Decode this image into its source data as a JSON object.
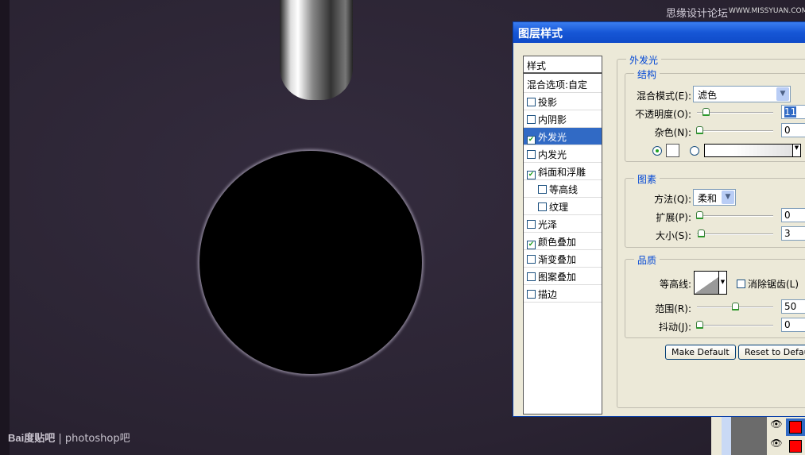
{
  "watermark_top": {
    "cn": "思缘设计论坛",
    "url": "WWW.MISSYUAN.COM"
  },
  "watermark_bottom": {
    "logo": "Bai度贴吧",
    "text": "photoshop吧"
  },
  "dialog": {
    "title": "图层样式",
    "styles_header": "样式",
    "blend_options": "混合选项:自定",
    "items": [
      {
        "label": "投影",
        "checked": false,
        "indent": false
      },
      {
        "label": "内阴影",
        "checked": false,
        "indent": false
      },
      {
        "label": "外发光",
        "checked": true,
        "indent": false,
        "selected": true
      },
      {
        "label": "内发光",
        "checked": false,
        "indent": false
      },
      {
        "label": "斜面和浮雕",
        "checked": true,
        "indent": false
      },
      {
        "label": "等高线",
        "checked": false,
        "indent": true
      },
      {
        "label": "纹理",
        "checked": false,
        "indent": true
      },
      {
        "label": "光泽",
        "checked": false,
        "indent": false
      },
      {
        "label": "颜色叠加",
        "checked": true,
        "indent": false
      },
      {
        "label": "渐变叠加",
        "checked": false,
        "indent": false
      },
      {
        "label": "图案叠加",
        "checked": false,
        "indent": false
      },
      {
        "label": "描边",
        "checked": false,
        "indent": false
      }
    ],
    "panel_title": "外发光",
    "structure": {
      "title": "结构",
      "blend_mode_label": "混合模式(E):",
      "blend_mode": "滤色",
      "opacity_label": "不透明度(O):",
      "opacity": "11",
      "noise_label": "杂色(N):",
      "noise": "0"
    },
    "elements": {
      "title": "图素",
      "technique_label": "方法(Q):",
      "technique": "柔和",
      "spread_label": "扩展(P):",
      "spread": "0",
      "size_label": "大小(S):",
      "size": "3"
    },
    "quality": {
      "title": "品质",
      "contour_label": "等高线:",
      "antialias_label": "消除锯齿(L)",
      "antialias": false,
      "range_label": "范围(R):",
      "range": "50",
      "jitter_label": "抖动(J):",
      "jitter": "0"
    },
    "make_default": "Make Default",
    "reset_default": "Reset to Default"
  },
  "colors": {
    "accent": "#316ac5",
    "titlebar": "#1656d6",
    "layer_swatch": "#ff0000"
  }
}
